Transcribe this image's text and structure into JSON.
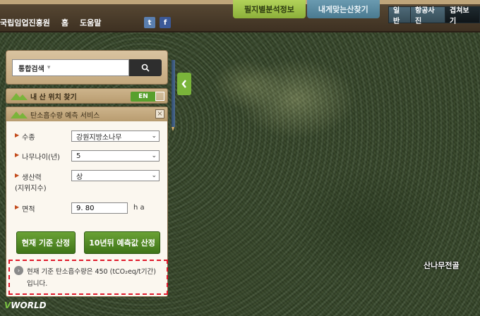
{
  "header": {
    "nav": [
      "국립임업진흥원",
      "홈",
      "도움말"
    ],
    "tabs": [
      {
        "label": "필지별분석정보",
        "active": true
      },
      {
        "label": "내게맞는산찾기",
        "active": false
      }
    ],
    "view_buttons": [
      "일반",
      "항공사진",
      "겹쳐보기"
    ],
    "social": {
      "twitter": "t",
      "facebook": "f"
    }
  },
  "search": {
    "select_label": "통합검색",
    "caret": "▾"
  },
  "location_finder": {
    "title": "내 산 위치 찾기",
    "badge": "EN"
  },
  "carbon_panel": {
    "title": "탄소흡수량 예측 서비스",
    "close": "×",
    "species_label": "수종",
    "species_value": "강원지방소나무",
    "age_label": "나무나이(년)",
    "age_value": "5",
    "productivity_label": "생산력",
    "productivity_sub": "(지위지수)",
    "productivity_value": "상",
    "area_label": "면적",
    "area_value": "9. 80",
    "area_unit": "h a",
    "btn_current": "현재 기준 산정",
    "btn_future": "10년뒤 예측값 산정",
    "result_line1": "현재 기준 탄소흡수량은 450 (tCO₂eq/t기간)",
    "result_line2": "입니다."
  },
  "map": {
    "place_label": "산나무전골",
    "brand": "VWORLD"
  },
  "colors": {
    "accent_green": "#6aa235",
    "panel_tan": "#cdb48b",
    "highlight_red": "#e0182a"
  }
}
